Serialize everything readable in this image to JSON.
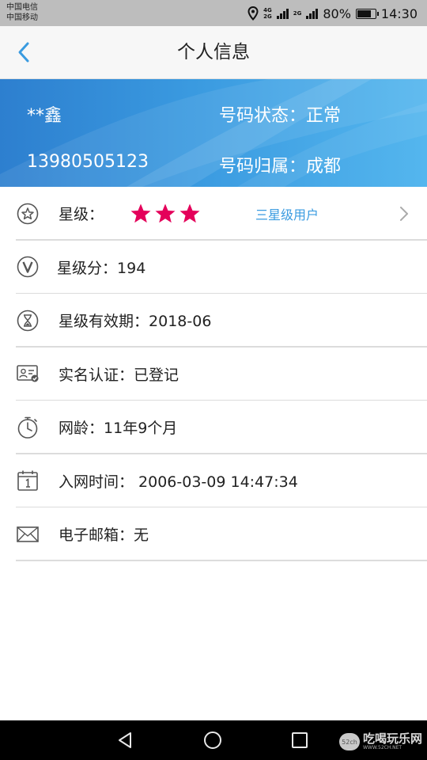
{
  "status_bar": {
    "carrier_1": "中国电信",
    "carrier_2": "中国移动",
    "net_4g": "4G\n2G",
    "net_2g": "2G",
    "battery_percent": "80%",
    "battery_level": 0.8,
    "time": "14:30"
  },
  "header": {
    "title": "个人信息",
    "back_icon": "chevron-left-icon"
  },
  "banner": {
    "name": "**鑫",
    "phone": "13980505123",
    "status_label": "号码状态：",
    "status_value": "正常",
    "region_label": "号码归属：",
    "region_value": "成都"
  },
  "rows": {
    "star_level": {
      "label": "星级：",
      "stars": 3,
      "star_color": "#e4005a",
      "level_text": "三星级用户",
      "icon": "star-circle-icon"
    },
    "star_score": {
      "label": "星级分：",
      "value": "194",
      "icon": "v-circle-icon"
    },
    "star_validity": {
      "label": "星级有效期：",
      "value": "2018-06",
      "icon": "hourglass-icon"
    },
    "real_name": {
      "label": "实名认证：",
      "value": "已登记",
      "icon": "id-card-icon"
    },
    "network_age": {
      "label": "网龄：",
      "value": "11年9个月",
      "icon": "stopwatch-icon"
    },
    "join_time": {
      "label": "入网时间：",
      "value": "2006-03-09 14:47:34",
      "icon": "calendar-icon"
    },
    "email": {
      "label": "电子邮箱：",
      "value": "无",
      "icon": "envelope-icon"
    }
  },
  "watermark": {
    "badge": "52ch",
    "main": "吃喝玩乐网",
    "sub": "WWW.52CH.NET"
  },
  "colors": {
    "accent_blue": "#3a9be0",
    "banner_start": "#2d7fcf",
    "banner_end": "#54b6ee",
    "star_pink": "#e4005a"
  }
}
